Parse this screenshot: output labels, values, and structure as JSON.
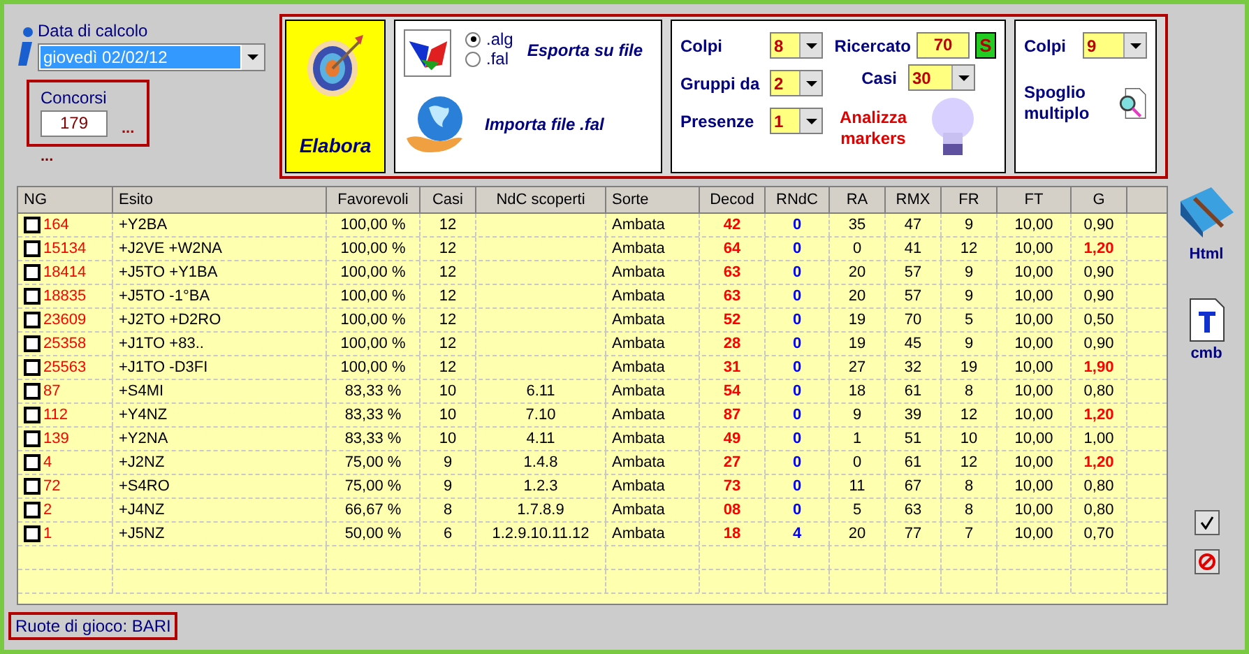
{
  "date": {
    "label": "Data di calcolo",
    "value": "giovedì 02/02/12"
  },
  "concorsi": {
    "label": "Concorsi",
    "value": "179",
    "more": "...",
    "more2": "..."
  },
  "elabora": "Elabora",
  "export": {
    "formats": [
      {
        "label": ".alg",
        "selected": true
      },
      {
        "label": ".fal",
        "selected": false
      }
    ],
    "export_label": "Esporta su file",
    "import_label": "Importa file .fal"
  },
  "params": {
    "colpi": {
      "label": "Colpi",
      "value": "8"
    },
    "gruppi": {
      "label": "Gruppi da",
      "value": "2"
    },
    "presenze": {
      "label": "Presenze",
      "value": "1"
    },
    "ricercato": {
      "label": "Ricercato",
      "value": "70"
    },
    "s_button": "S",
    "casi": {
      "label": "Casi",
      "value": "30"
    },
    "analizza": "Analizza markers"
  },
  "spoglio": {
    "colpi": {
      "label": "Colpi",
      "value": "9"
    },
    "label": "Spoglio multiplo"
  },
  "table": {
    "columns": [
      "NG",
      "Esito",
      "Favorevoli",
      "Casi",
      "NdC scoperti",
      "Sorte",
      "Decod",
      "RNdC",
      "RA",
      "RMX",
      "FR",
      "FT",
      "G"
    ],
    "rows": [
      {
        "checked": false,
        "cells": [
          "164",
          "+Y2BA",
          "100,00 %",
          "12",
          "",
          "Ambata",
          "42",
          "0",
          "35",
          "47",
          "9",
          "10,00",
          "0,90"
        ],
        "g_high": false
      },
      {
        "checked": false,
        "cells": [
          "15134",
          "+J2VE +W2NA",
          "100,00 %",
          "12",
          "",
          "Ambata",
          "64",
          "0",
          "0",
          "41",
          "12",
          "10,00",
          "1,20"
        ],
        "g_high": true
      },
      {
        "checked": false,
        "cells": [
          "18414",
          "+J5TO +Y1BA",
          "100,00 %",
          "12",
          "",
          "Ambata",
          "63",
          "0",
          "20",
          "57",
          "9",
          "10,00",
          "0,90"
        ],
        "g_high": false
      },
      {
        "checked": false,
        "cells": [
          "18835",
          "+J5TO -1°BA",
          "100,00 %",
          "12",
          "",
          "Ambata",
          "63",
          "0",
          "20",
          "57",
          "9",
          "10,00",
          "0,90"
        ],
        "g_high": false
      },
      {
        "checked": false,
        "cells": [
          "23609",
          "+J2TO +D2RO",
          "100,00 %",
          "12",
          "",
          "Ambata",
          "52",
          "0",
          "19",
          "70",
          "5",
          "10,00",
          "0,50"
        ],
        "g_high": false
      },
      {
        "checked": false,
        "cells": [
          "25358",
          "+J1TO +83..",
          "100,00 %",
          "12",
          "",
          "Ambata",
          "28",
          "0",
          "19",
          "45",
          "9",
          "10,00",
          "0,90"
        ],
        "g_high": false
      },
      {
        "checked": false,
        "cells": [
          "25563",
          "+J1TO -D3FI",
          "100,00 %",
          "12",
          "",
          "Ambata",
          "31",
          "0",
          "27",
          "32",
          "19",
          "10,00",
          "1,90"
        ],
        "g_high": true
      },
      {
        "checked": false,
        "cells": [
          "87",
          "+S4MI",
          "83,33 %",
          "10",
          "6.11",
          "Ambata",
          "54",
          "0",
          "18",
          "61",
          "8",
          "10,00",
          "0,80"
        ],
        "g_high": false
      },
      {
        "checked": false,
        "cells": [
          "112",
          "+Y4NZ",
          "83,33 %",
          "10",
          "7.10",
          "Ambata",
          "87",
          "0",
          "9",
          "39",
          "12",
          "10,00",
          "1,20"
        ],
        "g_high": true
      },
      {
        "checked": false,
        "cells": [
          "139",
          "+Y2NA",
          "83,33 %",
          "10",
          "4.11",
          "Ambata",
          "49",
          "0",
          "1",
          "51",
          "10",
          "10,00",
          "1,00"
        ],
        "g_high": false
      },
      {
        "checked": false,
        "cells": [
          "4",
          "+J2NZ",
          "75,00 %",
          "9",
          "1.4.8",
          "Ambata",
          "27",
          "0",
          "0",
          "61",
          "12",
          "10,00",
          "1,20"
        ],
        "g_high": true
      },
      {
        "checked": false,
        "cells": [
          "72",
          "+S4RO",
          "75,00 %",
          "9",
          "1.2.3",
          "Ambata",
          "73",
          "0",
          "11",
          "67",
          "8",
          "10,00",
          "0,80"
        ],
        "g_high": false
      },
      {
        "checked": false,
        "cells": [
          "2",
          "+J4NZ",
          "66,67 %",
          "8",
          "1.7.8.9",
          "Ambata",
          "08",
          "0",
          "5",
          "63",
          "8",
          "10,00",
          "0,80"
        ],
        "g_high": false
      },
      {
        "checked": false,
        "cells": [
          "1",
          "+J5NZ",
          "50,00 %",
          "6",
          "1.2.9.10.11.12",
          "Ambata",
          "18",
          "4",
          "20",
          "77",
          "7",
          "10,00",
          "0,70"
        ],
        "g_high": false
      }
    ]
  },
  "side": {
    "html": "Html",
    "cmb": "cmb"
  },
  "status": "Ruote di gioco: BARI"
}
